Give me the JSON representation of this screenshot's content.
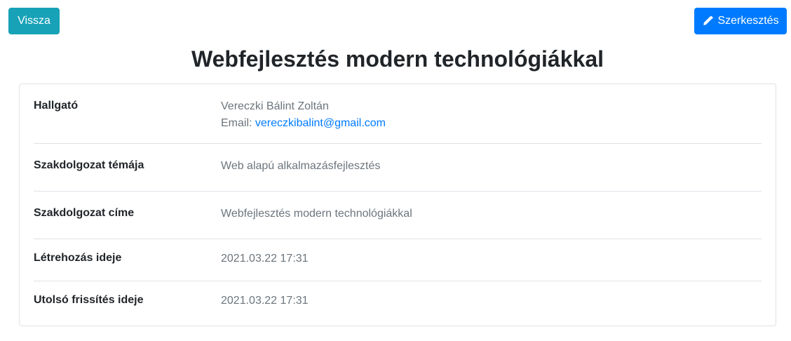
{
  "header": {
    "back_label": "Vissza",
    "edit_label": "Szerkesztés",
    "edit_icon": "pencil-icon",
    "title": "Webfejlesztés modern technológiákkal"
  },
  "colors": {
    "back_button": "#17a2b8",
    "edit_button": "#007bff",
    "link": "#007bff",
    "value_text": "#6c757d"
  },
  "details": {
    "student": {
      "label": "Hallgató",
      "name": "Vereczki Bálint Zoltán",
      "email_prefix": "Email:",
      "email": "vereczkibalint@gmail.com"
    },
    "topic": {
      "label": "Szakdolgozat témája",
      "value": "Web alapú alkalmazásfejlesztés"
    },
    "thesis_title": {
      "label": "Szakdolgozat címe",
      "value": "Webfejlesztés modern technológiákkal"
    },
    "created": {
      "label": "Létrehozás ideje",
      "value": "2021.03.22 17:31"
    },
    "updated": {
      "label": "Utolsó frissítés ideje",
      "value": "2021.03.22 17:31"
    }
  }
}
